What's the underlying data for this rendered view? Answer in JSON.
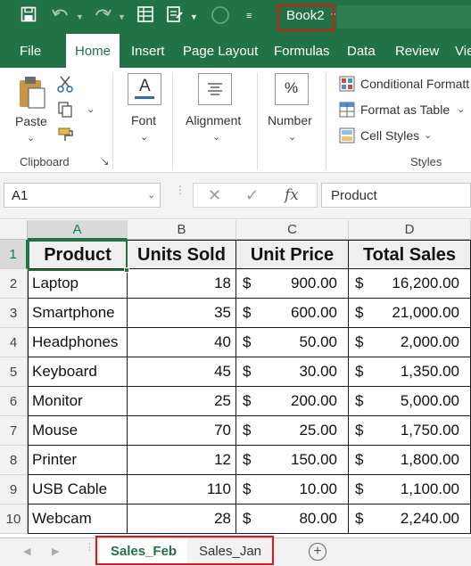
{
  "titlebar": {
    "workbook_name": "Book2",
    "dots": "···",
    "colors": {
      "bar": "#217346",
      "highlight_box": "#e0151a"
    },
    "quick_access_icons": [
      "save-icon",
      "undo-icon",
      "redo-icon",
      "form-icon",
      "touch-mode-icon",
      "autosave-toggle-icon",
      "customize-qat-icon"
    ]
  },
  "ribbon_tabs": [
    "File",
    "Home",
    "Insert",
    "Page Layout",
    "Formulas",
    "Data",
    "Review",
    "Vie"
  ],
  "ribbon": {
    "clipboard": {
      "paste": "Paste",
      "group_label": "Clipboard"
    },
    "font": {
      "label": "Font",
      "glyph": "A"
    },
    "alignment": {
      "label": "Alignment"
    },
    "number": {
      "label": "Number",
      "glyph": "%"
    },
    "styles": {
      "conditional": "Conditional Formatt",
      "format_table": "Format as Table",
      "cell_styles": "Cell Styles",
      "group_label": "Styles"
    }
  },
  "formula_bar": {
    "name_box": "A1",
    "fx": "fx",
    "content": "Product"
  },
  "grid": {
    "columns": [
      "A",
      "B",
      "C",
      "D"
    ],
    "row_numbers": [
      "1",
      "2",
      "3",
      "4",
      "5",
      "6",
      "7",
      "8",
      "9",
      "10"
    ],
    "headers": [
      "Product",
      "Units Sold",
      "Unit Price",
      "Total Sales"
    ],
    "currency": "$",
    "rows": [
      {
        "product": "Laptop",
        "units": "18",
        "price": "900.00",
        "total": "16,200.00"
      },
      {
        "product": "Smartphone",
        "units": "35",
        "price": "600.00",
        "total": "21,000.00"
      },
      {
        "product": "Headphones",
        "units": "40",
        "price": "50.00",
        "total": "2,000.00"
      },
      {
        "product": "Keyboard",
        "units": "45",
        "price": "30.00",
        "total": "1,350.00"
      },
      {
        "product": "Monitor",
        "units": "25",
        "price": "200.00",
        "total": "5,000.00"
      },
      {
        "product": "Mouse",
        "units": "70",
        "price": "25.00",
        "total": "1,750.00"
      },
      {
        "product": "Printer",
        "units": "12",
        "price": "150.00",
        "total": "1,800.00"
      },
      {
        "product": "USB Cable",
        "units": "110",
        "price": "10.00",
        "total": "1,100.00"
      },
      {
        "product": "Webcam",
        "units": "28",
        "price": "80.00",
        "total": "2,240.00"
      }
    ]
  },
  "sheets": {
    "tabs": [
      "Sales_Feb",
      "Sales_Jan"
    ],
    "active": "Sales_Feb",
    "add_glyph": "+"
  }
}
